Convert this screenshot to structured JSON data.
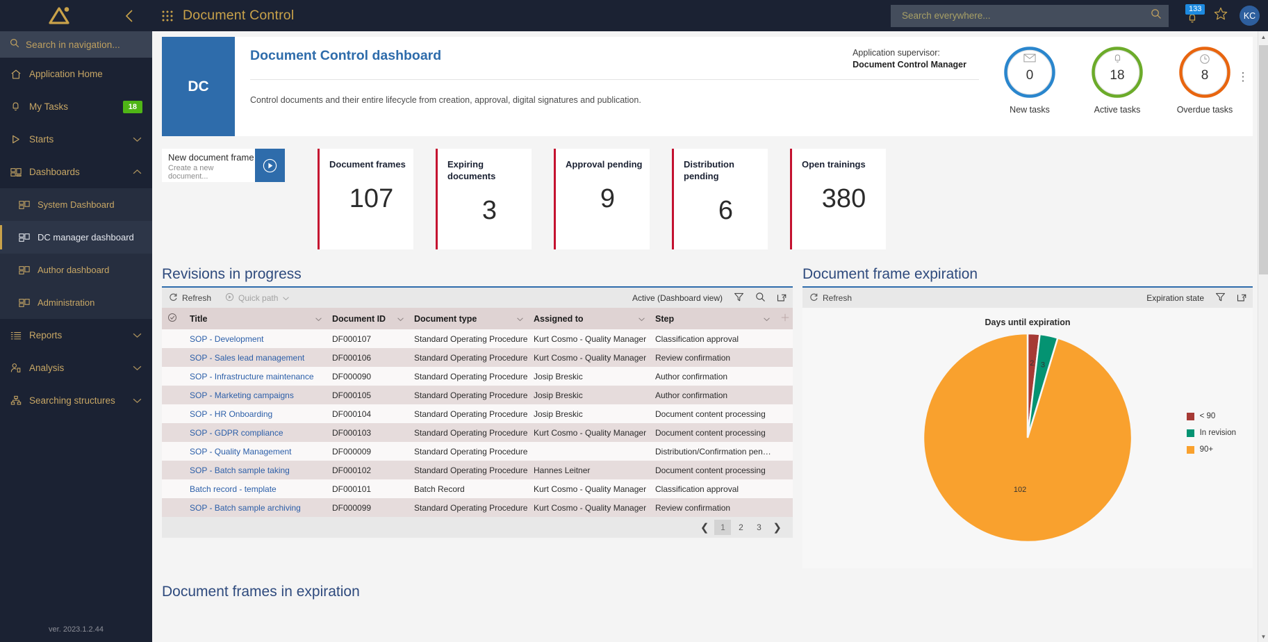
{
  "sidebar": {
    "logo_icon": "triangle-logo",
    "collapse_icon": "chevron-left-icon",
    "search_placeholder": "Search in navigation...",
    "version": "ver. 2023.1.2.44",
    "items": [
      {
        "label": "Application Home",
        "icon": "home-icon",
        "badge": null,
        "chevron": null
      },
      {
        "label": "My Tasks",
        "icon": "bell-icon",
        "badge": "18",
        "chevron": null
      },
      {
        "label": "Starts",
        "icon": "play-icon",
        "badge": null,
        "chevron": "down"
      },
      {
        "label": "Dashboards",
        "icon": "dashboard-icon",
        "badge": null,
        "chevron": "up"
      }
    ],
    "sub_items": [
      {
        "label": "System Dashboard",
        "icon": "dashboard-icon",
        "active": false
      },
      {
        "label": "DC manager dashboard",
        "icon": "dashboard-icon",
        "active": true
      },
      {
        "label": "Author dashboard",
        "icon": "dashboard-icon",
        "active": false
      },
      {
        "label": "Administration",
        "icon": "dashboard-icon",
        "active": false
      }
    ],
    "items_after": [
      {
        "label": "Reports",
        "icon": "list-icon",
        "badge": null,
        "chevron": "down"
      },
      {
        "label": "Analysis",
        "icon": "person-analysis-icon",
        "badge": null,
        "chevron": "down"
      },
      {
        "label": "Searching structures",
        "icon": "hierarchy-icon",
        "badge": null,
        "chevron": "down"
      }
    ]
  },
  "topbar": {
    "app_menu_icon": "grid-apps-icon",
    "title": "Document Control",
    "search_placeholder": "Search everywhere...",
    "search_value": "",
    "search_icon": "search-icon",
    "notification_count": "133",
    "notification_icon": "bell-icon",
    "favorite_icon": "star-icon",
    "avatar_initials": "KC"
  },
  "app_header": {
    "tile_initials": "DC",
    "title": "Document Control dashboard",
    "supervisor_label": "Application supervisor:",
    "supervisor_name": "Document Control Manager",
    "description": "Control documents and their entire lifecycle from creation, approval, digital signatures and publication.",
    "kebab_icon": "more-vertical-icon",
    "donuts": [
      {
        "value": "0",
        "label": "New tasks",
        "color": "#2a86cd",
        "icon": "envelope-icon"
      },
      {
        "value": "18",
        "label": "Active tasks",
        "color": "#6cab2a",
        "icon": "bell-icon"
      },
      {
        "value": "8",
        "label": "Overdue tasks",
        "color": "#e8650f",
        "icon": "clock-icon"
      }
    ]
  },
  "new_frame_tile": {
    "title": "New document frame",
    "subtitle": "Create a new document...",
    "play_icon": "play-circle-icon"
  },
  "kpis": [
    {
      "title": "Document frames",
      "value": "107",
      "accent": "#c41230"
    },
    {
      "title": "Expiring documents",
      "value": "3",
      "accent": "#c41230"
    },
    {
      "title": "Approval pending",
      "value": "9",
      "accent": "#c41230"
    },
    {
      "title": "Distribution pending",
      "value": "6",
      "accent": "#c41230"
    },
    {
      "title": "Open trainings",
      "value": "380",
      "accent": "#c41230"
    }
  ],
  "revisions_panel": {
    "title": "Revisions in progress",
    "refresh_label": "Refresh",
    "refresh_icon": "refresh-icon",
    "quickpath_label": "Quick path",
    "quickpath_icon": "play-circle-icon",
    "quickpath_chevron": "chevron-down-icon",
    "view_name": "Active (Dashboard view)",
    "filter_icon": "funnel-icon",
    "search_icon": "search-icon",
    "export_icon": "open-external-icon",
    "select_all_icon": "check-circle-icon",
    "add_column_icon": "plus-icon",
    "columns": [
      "Title",
      "Document ID",
      "Document type",
      "Assigned to",
      "Step"
    ],
    "rows": [
      {
        "title": "SOP - Development",
        "doc_id": "DF000107",
        "doc_type": "Standard Operating Procedure",
        "assigned": "Kurt Cosmo - Quality Manager",
        "step": "Classification approval"
      },
      {
        "title": "SOP - Sales lead management",
        "doc_id": "DF000106",
        "doc_type": "Standard Operating Procedure",
        "assigned": "Kurt Cosmo - Quality Manager",
        "step": "Review confirmation"
      },
      {
        "title": "SOP - Infrastructure maintenance",
        "doc_id": "DF000090",
        "doc_type": "Standard Operating Procedure",
        "assigned": "Josip Breskic",
        "step": "Author confirmation"
      },
      {
        "title": "SOP - Marketing campaigns",
        "doc_id": "DF000105",
        "doc_type": "Standard Operating Procedure",
        "assigned": "Josip Breskic",
        "step": "Author confirmation"
      },
      {
        "title": "SOP - HR Onboarding",
        "doc_id": "DF000104",
        "doc_type": "Standard Operating Procedure",
        "assigned": "Josip Breskic",
        "step": "Document content processing"
      },
      {
        "title": "SOP - GDPR compliance",
        "doc_id": "DF000103",
        "doc_type": "Standard Operating Procedure",
        "assigned": "Kurt Cosmo - Quality Manager",
        "step": "Document content processing"
      },
      {
        "title": "SOP - Quality Management",
        "doc_id": "DF000009",
        "doc_type": "Standard Operating Procedure",
        "assigned": "",
        "step": "Distribution/Confirmation pending"
      },
      {
        "title": "SOP - Batch sample taking",
        "doc_id": "DF000102",
        "doc_type": "Standard Operating Procedure",
        "assigned": "Hannes Leitner",
        "step": "Document content processing"
      },
      {
        "title": "Batch record - template",
        "doc_id": "DF000101",
        "doc_type": "Batch Record",
        "assigned": "Kurt Cosmo - Quality Manager",
        "step": "Classification approval"
      },
      {
        "title": "SOP - Batch sample archiving",
        "doc_id": "DF000099",
        "doc_type": "Standard Operating Procedure",
        "assigned": "Kurt Cosmo - Quality Manager",
        "step": "Review confirmation"
      }
    ],
    "pager": {
      "prev_icon": "chevron-left-icon",
      "next_icon": "chevron-right-icon",
      "pages": [
        "1",
        "2",
        "3"
      ],
      "current": "1"
    }
  },
  "expiration_panel": {
    "title": "Document frame expiration",
    "refresh_label": "Refresh",
    "refresh_icon": "refresh-icon",
    "expiration_state_label": "Expiration state",
    "filter_icon": "funnel-icon",
    "export_icon": "open-external-icon"
  },
  "bottom_panel": {
    "title": "Document frames in expiration"
  },
  "chart_data": {
    "type": "pie",
    "title": "Days until expiration",
    "categories": [
      "< 90",
      "In revision",
      "90+"
    ],
    "values": [
      2,
      3,
      102
    ],
    "colors": [
      "#a63a35",
      "#049372",
      "#f9a12e"
    ],
    "labels": [
      "2",
      "3",
      "102"
    ],
    "legend_position": "right",
    "grid": false
  }
}
